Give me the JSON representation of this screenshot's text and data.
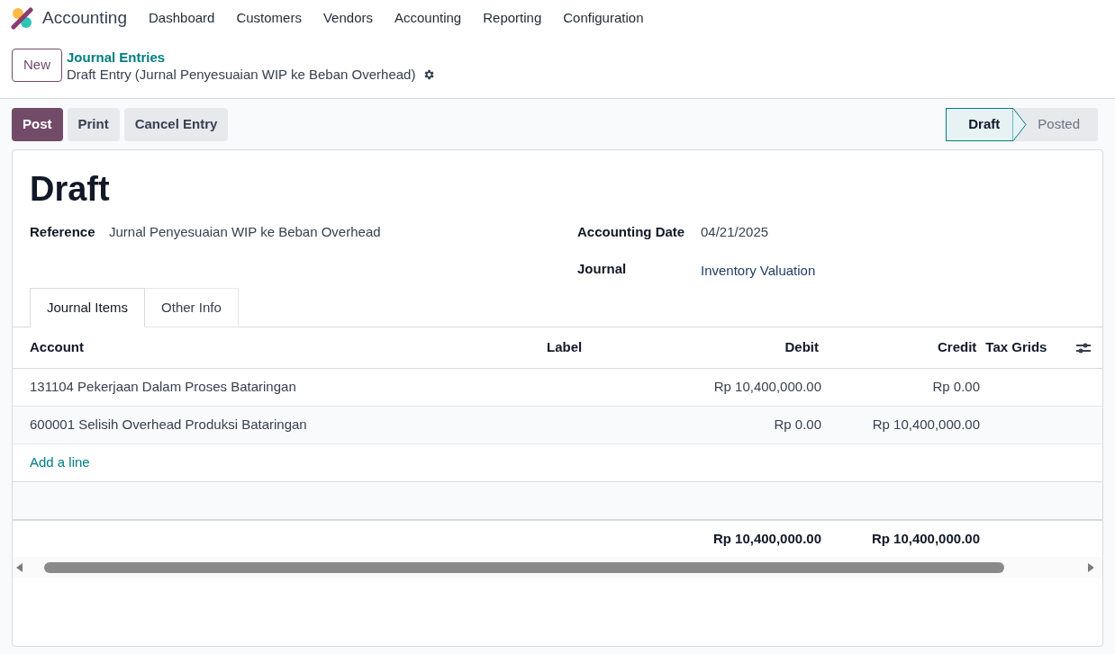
{
  "navbar": {
    "app_name": "Accounting",
    "menu": [
      "Dashboard",
      "Customers",
      "Vendors",
      "Accounting",
      "Reporting",
      "Configuration"
    ]
  },
  "control_panel": {
    "new_button": "New",
    "breadcrumb": "Journal Entries",
    "record_title": "Draft Entry (Jurnal Penyesuaian WIP ke Beban Overhead)"
  },
  "actions": [
    "Post",
    "Print",
    "Cancel Entry"
  ],
  "status_stages": [
    {
      "label": "Draft",
      "selected": true
    },
    {
      "label": "Posted",
      "selected": false
    }
  ],
  "form": {
    "title": "Draft",
    "left_fields": [
      {
        "label": "Reference",
        "value": "Jurnal Penyesuaian WIP ke Beban Overhead"
      }
    ],
    "right_fields": [
      {
        "label": "Accounting Date",
        "value": "04/21/2025"
      },
      {
        "label": "Journal",
        "value": "Inventory Valuation"
      }
    ]
  },
  "tabs": [
    {
      "label": "Journal Items",
      "selected": true
    },
    {
      "label": "Other Info",
      "selected": false
    }
  ],
  "table": {
    "columns": [
      "Account",
      "Label",
      "Debit",
      "Credit",
      "Tax Grids"
    ],
    "rows": [
      {
        "account": "131104 Pekerjaan Dalam Proses Bataringan",
        "label": "",
        "debit": "Rp 10,400,000.00",
        "credit": "Rp 0.00"
      },
      {
        "account": "600001 Selisih Overhead Produksi Bataringan",
        "label": "",
        "debit": "Rp 0.00",
        "credit": "Rp 10,400,000.00"
      }
    ],
    "add_line": "Add a line",
    "totals": {
      "debit": "Rp 10,400,000.00",
      "credit": "Rp 10,400,000.00"
    }
  }
}
